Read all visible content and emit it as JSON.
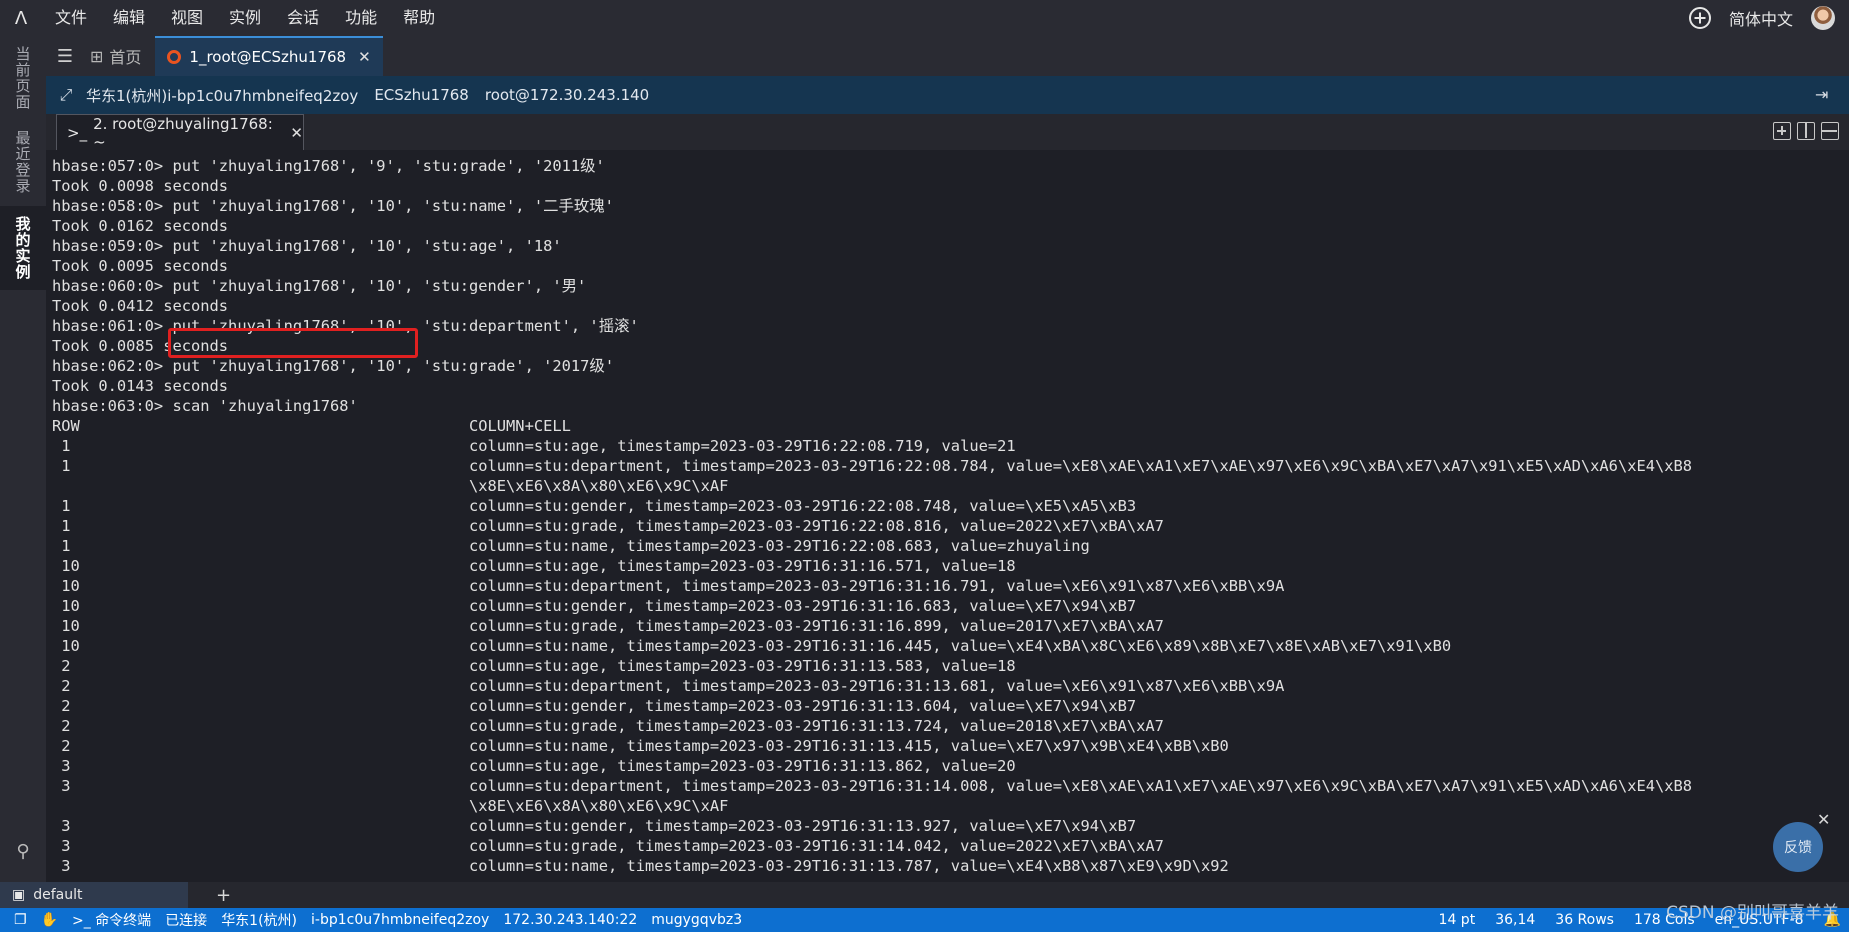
{
  "menubar": {
    "logo": "Λ",
    "items": [
      "文件",
      "编辑",
      "视图",
      "实例",
      "会话",
      "功能",
      "帮助"
    ],
    "language": "简体中文"
  },
  "leftrail": {
    "items": [
      "当前页面",
      "最近登录",
      "我的实例"
    ],
    "active": "我的实例"
  },
  "tabs": {
    "home": "首页",
    "session": "1_root@ECSzhu1768"
  },
  "hostbar": {
    "region_instance": "华东1(杭州)i-bp1c0u7hmbneifeq2zoy",
    "host_name": "ECSzhu1768",
    "login": "root@172.30.243.140"
  },
  "terminal_tab": {
    "label": "2. root@zhuyaling1768: ~"
  },
  "terminal": {
    "lines": [
      "hbase:057:0> put 'zhuyaling1768', '9', 'stu:grade', '2011级'",
      "Took 0.0098 seconds",
      "hbase:058:0> put 'zhuyaling1768', '10', 'stu:name', '二手玫瑰'",
      "Took 0.0162 seconds",
      "hbase:059:0> put 'zhuyaling1768', '10', 'stu:age', '18'",
      "Took 0.0095 seconds",
      "hbase:060:0> put 'zhuyaling1768', '10', 'stu:gender', '男'",
      "Took 0.0412 seconds",
      "hbase:061:0> put 'zhuyaling1768', '10', 'stu:department', '摇滚'",
      "Took 0.0085 seconds",
      "hbase:062:0> put 'zhuyaling1768', '10', 'stu:grade', '2017级'",
      "Took 0.0143 seconds",
      "hbase:063:0> scan 'zhuyaling1768'",
      "ROW                                          COLUMN+CELL",
      " 1                                           column=stu:age, timestamp=2023-03-29T16:22:08.719, value=21",
      " 1                                           column=stu:department, timestamp=2023-03-29T16:22:08.784, value=\\xE8\\xAE\\xA1\\xE7\\xAE\\x97\\xE6\\x9C\\xBA\\xE7\\xA7\\x91\\xE5\\xAD\\xA6\\xE4\\xB8",
      "                                             \\x8E\\xE6\\x8A\\x80\\xE6\\x9C\\xAF",
      " 1                                           column=stu:gender, timestamp=2023-03-29T16:22:08.748, value=\\xE5\\xA5\\xB3",
      " 1                                           column=stu:grade, timestamp=2023-03-29T16:22:08.816, value=2022\\xE7\\xBA\\xA7",
      " 1                                           column=stu:name, timestamp=2023-03-29T16:22:08.683, value=zhuyaling",
      " 10                                          column=stu:age, timestamp=2023-03-29T16:31:16.571, value=18",
      " 10                                          column=stu:department, timestamp=2023-03-29T16:31:16.791, value=\\xE6\\x91\\x87\\xE6\\xBB\\x9A",
      " 10                                          column=stu:gender, timestamp=2023-03-29T16:31:16.683, value=\\xE7\\x94\\xB7",
      " 10                                          column=stu:grade, timestamp=2023-03-29T16:31:16.899, value=2017\\xE7\\xBA\\xA7",
      " 10                                          column=stu:name, timestamp=2023-03-29T16:31:16.445, value=\\xE4\\xBA\\x8C\\xE6\\x89\\x8B\\xE7\\x8E\\xAB\\xE7\\x91\\xB0",
      " 2                                           column=stu:age, timestamp=2023-03-29T16:31:13.583, value=18",
      " 2                                           column=stu:department, timestamp=2023-03-29T16:31:13.681, value=\\xE6\\x91\\x87\\xE6\\xBB\\x9A",
      " 2                                           column=stu:gender, timestamp=2023-03-29T16:31:13.604, value=\\xE7\\x94\\xB7",
      " 2                                           column=stu:grade, timestamp=2023-03-29T16:31:13.724, value=2018\\xE7\\xBA\\xA7",
      " 2                                           column=stu:name, timestamp=2023-03-29T16:31:13.415, value=\\xE7\\x97\\x9B\\xE4\\xBB\\xB0",
      " 3                                           column=stu:age, timestamp=2023-03-29T16:31:13.862, value=20",
      " 3                                           column=stu:department, timestamp=2023-03-29T16:31:14.008, value=\\xE8\\xAE\\xA1\\xE7\\xAE\\x97\\xE6\\x9C\\xBA\\xE7\\xA7\\x91\\xE5\\xAD\\xA6\\xE4\\xB8",
      "                                             \\x8E\\xE6\\x8A\\x80\\xE6\\x9C\\xAF",
      " 3                                           column=stu:gender, timestamp=2023-03-29T16:31:13.927, value=\\xE7\\x94\\xB7",
      " 3                                           column=stu:grade, timestamp=2023-03-29T16:31:14.042, value=2022\\xE7\\xBA\\xA7",
      " 3                                           column=stu:name, timestamp=2023-03-29T16:31:13.787, value=\\xE4\\xB8\\x87\\xE9\\x9D\\x92"
    ]
  },
  "feedback": {
    "label": "反馈"
  },
  "sessionbar": {
    "tab": "default"
  },
  "statusbar": {
    "terminal_type": "命令终端",
    "connection": "已连接",
    "region": "华东1(杭州)",
    "instance_id": "i-bp1c0u7hmbneifeq2zoy",
    "address": "172.30.243.140:22",
    "session_id": "mugygqvbz3",
    "font_size": "14 pt",
    "cursor_pos": "36,14",
    "rows": "36 Rows",
    "cols": "178 Cols",
    "encoding": "en_US.UTF-8"
  },
  "watermark": "CSDN @别叫哥喜羊羊",
  "colors": {
    "accent": "#0d6fd0",
    "highlight_box": "#e02020",
    "terminal_bg": "#1e1f26"
  }
}
